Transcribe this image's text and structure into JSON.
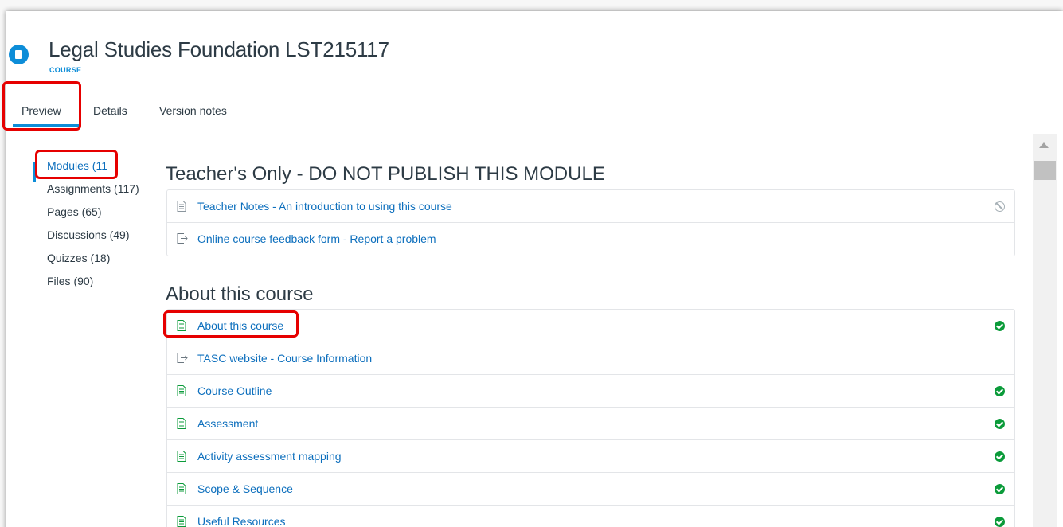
{
  "header": {
    "title": "Legal Studies Foundation LST215117",
    "subtitle": "COURSE",
    "icon": "book-icon"
  },
  "tabs": [
    {
      "label": "Preview",
      "active": true
    },
    {
      "label": "Details",
      "active": false
    },
    {
      "label": "Version notes",
      "active": false
    }
  ],
  "sidebar": {
    "items": [
      {
        "label": "Modules (11",
        "active": true
      },
      {
        "label": "Assignments (117)",
        "active": false
      },
      {
        "label": "Pages (65)",
        "active": false
      },
      {
        "label": "Discussions (49)",
        "active": false
      },
      {
        "label": "Quizzes (18)",
        "active": false
      },
      {
        "label": "Files (90)",
        "active": false
      }
    ]
  },
  "modules": [
    {
      "title": "Teacher's Only - DO NOT PUBLISH THIS MODULE",
      "items": [
        {
          "label": "Teacher Notes - An introduction to using this course",
          "type": "page-icon",
          "status": "unpublished"
        },
        {
          "label": "Online course feedback form - Report a problem",
          "type": "external-link-icon",
          "status": "none"
        }
      ]
    },
    {
      "title": "About this course",
      "items": [
        {
          "label": "About this course",
          "type": "page-icon",
          "status": "published"
        },
        {
          "label": "TASC website - Course Information",
          "type": "external-link-icon",
          "status": "none"
        },
        {
          "label": "Course Outline",
          "type": "page-icon",
          "status": "published"
        },
        {
          "label": "Assessment",
          "type": "page-icon",
          "status": "published"
        },
        {
          "label": "Activity assessment mapping",
          "type": "page-icon",
          "status": "published"
        },
        {
          "label": "Scope & Sequence",
          "type": "page-icon",
          "status": "published"
        },
        {
          "label": "Useful Resources",
          "type": "page-icon",
          "status": "published"
        }
      ]
    }
  ],
  "colors": {
    "accent": "#0d8dd8",
    "link": "#0d6fbd",
    "published": "#0b9b3a",
    "highlight": "#e60000"
  }
}
